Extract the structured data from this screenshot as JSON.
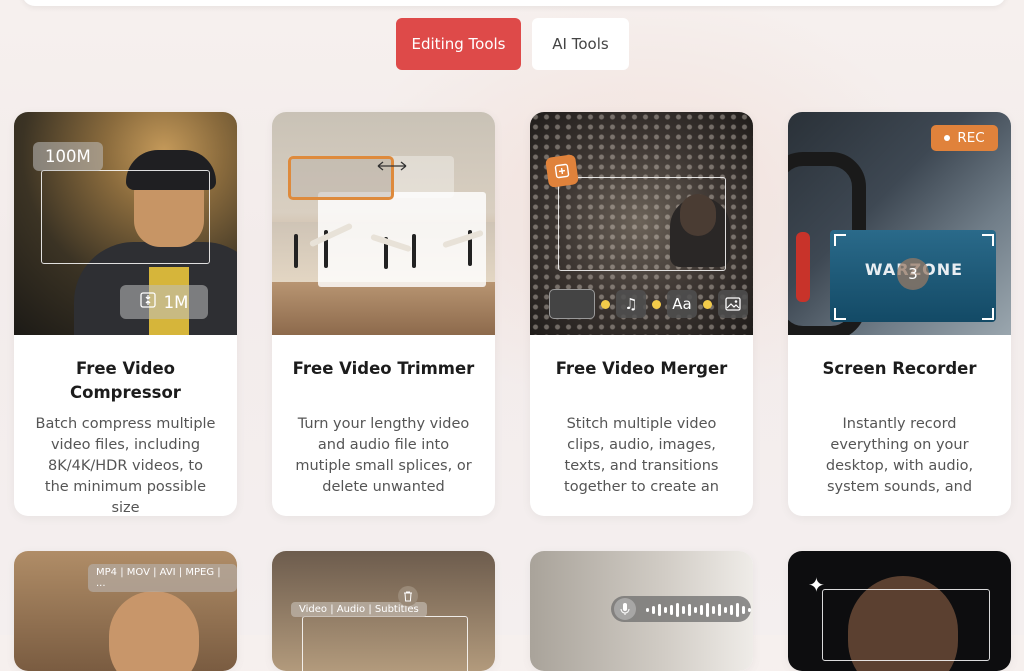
{
  "tabs": [
    {
      "label": "Editing Tools",
      "active": true
    },
    {
      "label": "AI Tools",
      "active": false
    }
  ],
  "colors": {
    "accent": "#de4a49",
    "orange": "#e0823b"
  },
  "cards": [
    {
      "title": "Free Video Compressor",
      "description": "Batch compress multiple video files, including 8K/4K/HDR videos, to the minimum possible size",
      "overlay": {
        "before_size": "100M",
        "after_size": "1M",
        "icon": "compress-icon"
      }
    },
    {
      "title": "Free Video Trimmer",
      "description": "Turn your lengthy video and audio file into mutiple small splices, or delete unwanted",
      "overlay": {
        "icon": "resize-arrows-icon"
      }
    },
    {
      "title": "Free Video Merger",
      "description": "Stitch multiple video clips, audio, images, texts, and transitions together to create an",
      "overlay": {
        "text_tool": "Aa",
        "icons": [
          "merge-icon",
          "music-note-icon",
          "text-icon",
          "image-icon"
        ]
      }
    },
    {
      "title": "Screen Recorder",
      "description": "Instantly record everything on your desktop, with audio, system sounds, and",
      "overlay": {
        "rec_label": "REC",
        "countdown": "3",
        "game_title": "WARZONE"
      }
    },
    {
      "overlay": {
        "formats": "MP4 | MOV | AVI | MPEG | ..."
      }
    },
    {
      "overlay": {
        "types": "Video | Audio | Subtitles",
        "icon": "trash-icon"
      }
    },
    {
      "overlay": {
        "icon": "microphone-icon"
      }
    },
    {
      "overlay": {
        "icon": "magic-sparkle-icon"
      }
    }
  ]
}
